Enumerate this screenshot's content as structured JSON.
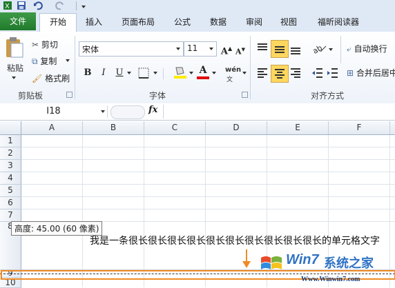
{
  "ribbon_tabs": {
    "file": "文件",
    "home": "开始",
    "insert": "插入",
    "page_layout": "页面布局",
    "formulas": "公式",
    "data": "数据",
    "review": "审阅",
    "view": "视图",
    "foxit": "福昕阅读器"
  },
  "clipboard": {
    "paste": "粘贴",
    "cut": "剪切",
    "copy": "复制",
    "format_painter": "格式刷",
    "group_label": "剪贴板"
  },
  "font": {
    "name": "宋体",
    "size": "11",
    "group_label": "字体",
    "bold": "B",
    "italic": "I",
    "underline": "U",
    "phonetic": "wén"
  },
  "alignment": {
    "wrap_text": "自动换行",
    "merge_center": "合并后居中",
    "group_label": "对齐方式"
  },
  "formula_bar": {
    "cell_ref": "I18",
    "fx": "fx",
    "content": ""
  },
  "columns": [
    "A",
    "B",
    "C",
    "D",
    "E",
    "F"
  ],
  "rows": [
    "1",
    "2",
    "3",
    "4",
    "5",
    "6",
    "7",
    "8",
    "9",
    "10"
  ],
  "cell_text": "我是一条很长很长很长很长很长很长很长很长很长很长的单元格文字",
  "tooltip": "高度: 45.00 (60 像素)",
  "watermark": {
    "brand_a": "Win7",
    "brand_b": "系统之家",
    "url": "Www.Winwin7.com"
  },
  "colors": {
    "file_tab": "#2a8a36",
    "highlight": "#ffd75e",
    "font_color": "#e00000",
    "selection_border": "#f08a24"
  }
}
